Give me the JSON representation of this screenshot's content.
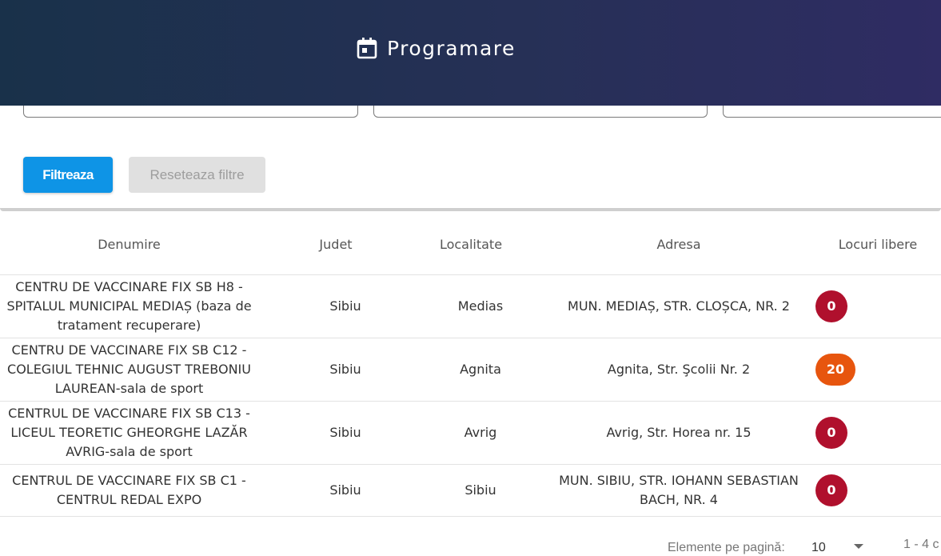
{
  "header": {
    "title": "Programare",
    "icon": "calendar-icon"
  },
  "filters": {
    "filter_button": "Filtreaza",
    "reset_button": "Reseteaza filtre"
  },
  "table": {
    "columns": [
      "Denumire",
      "Judet",
      "Localitate",
      "Adresa",
      "Locuri libere"
    ],
    "rows": [
      {
        "denumire": "CENTRU DE VACCINARE FIX SB H8 - SPITALUL MUNICIPAL MEDIAȘ (baza de tratament recuperare)",
        "judet": "Sibiu",
        "localitate": "Medias",
        "adresa": "MUN. MEDIAȘ, STR. CLOȘCA, NR. 2",
        "locuri": "0",
        "badge_color": "#b0102d"
      },
      {
        "denumire": "CENTRU DE VACCINARE FIX SB C12 - COLEGIUL TEHNIC AUGUST TREBONIU LAUREAN-sala de sport",
        "judet": "Sibiu",
        "localitate": "Agnita",
        "adresa": "Agnita, Str. Şcolii Nr. 2",
        "locuri": "20",
        "badge_color": "#e7550e"
      },
      {
        "denumire": "CENTRUL DE VACCINARE FIX SB C13 - LICEUL TEORETIC GHEORGHE LAZĂR AVRIG-sala de sport",
        "judet": "Sibiu",
        "localitate": "Avrig",
        "adresa": "Avrig, Str. Horea nr. 15",
        "locuri": "0",
        "badge_color": "#b0102d"
      },
      {
        "denumire": "CENTRUL DE VACCINARE FIX SB C1 - CENTRUL REDAL EXPO",
        "judet": "Sibiu",
        "localitate": "Sibiu",
        "adresa": "MUN. SIBIU, STR. IOHANN SEBASTIAN BACH, NR. 4",
        "locuri": "0",
        "badge_color": "#b0102d"
      }
    ]
  },
  "paginator": {
    "label": "Elemente pe pagină:",
    "page_size": "10",
    "range": "1 - 4 c"
  }
}
